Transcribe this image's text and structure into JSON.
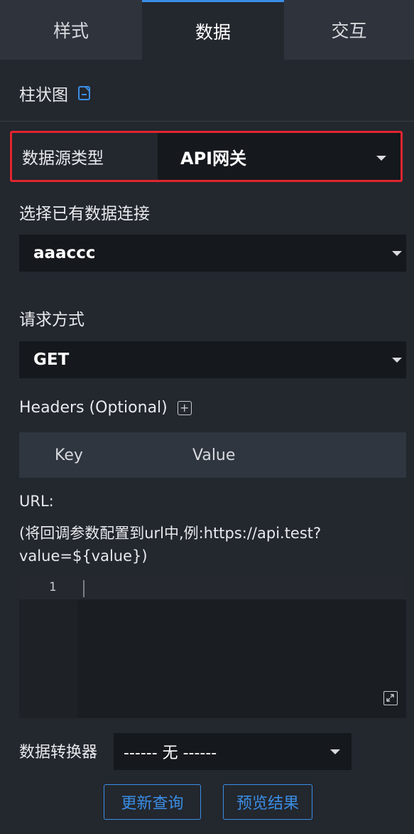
{
  "tabs": [
    {
      "label": "样式"
    },
    {
      "label": "数据"
    },
    {
      "label": "交互"
    }
  ],
  "active_tab": "数据",
  "component_title": "柱状图",
  "data_source": {
    "label": "数据源类型",
    "value": "API网关"
  },
  "connection": {
    "label": "选择已有数据连接",
    "value": "aaaccc"
  },
  "request_method": {
    "label": "请求方式",
    "value": "GET"
  },
  "headers": {
    "label": "Headers (Optional)",
    "columns": [
      "Key",
      "Value"
    ]
  },
  "url": {
    "label": "URL:",
    "hint": "(将回调参数配置到url中,例:https://api.test?value=${value})"
  },
  "editor": {
    "line_number": "1"
  },
  "converter": {
    "label": "数据转换器",
    "value": "------ 无 ------"
  },
  "buttons": {
    "update": "更新查询",
    "preview": "预览结果"
  },
  "colors": {
    "accent": "#3a8ee6",
    "highlight_border": "#e0252f",
    "background": "#23272e"
  }
}
